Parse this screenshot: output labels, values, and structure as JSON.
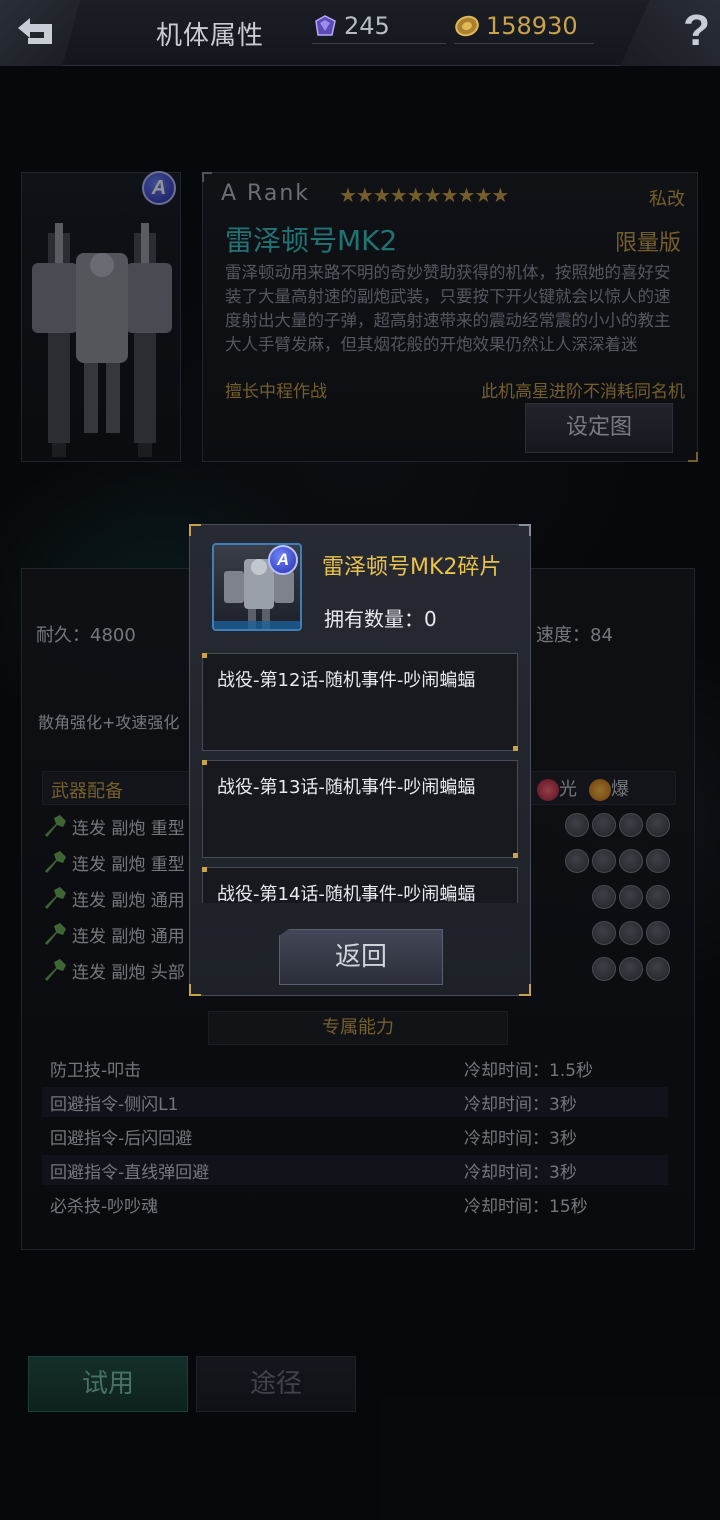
{
  "header": {
    "back_icon": "back-arrow-icon",
    "title": "机体属性",
    "diamonds": "245",
    "gold": "158930",
    "help_icon": "question-mark-icon"
  },
  "mech": {
    "rank_badge": "A",
    "rank_label": "A  Rank",
    "stars": "★★★★★★★★★★",
    "private_tag": "私改",
    "name": "雷泽顿号MK2",
    "limited_tag": "限量版",
    "description": "雷泽顿动用来路不明的奇妙赞助获得的机体，按照她的喜好安装了大量高射速的副炮武装，只要按下开火键就会以惊人的速度射出大量的子弹，超高射速带来的震动经常震的小小的教主大人手臂发麻，但其烟花般的开炮效果仍然让人深深着迷",
    "skill_tag": "擅长中程作战",
    "star_note": "此机高星进阶不消耗同名机",
    "set_image_label": "设定图"
  },
  "stats": {
    "durability": "耐久：4800",
    "speed": "速度：84",
    "buff": "散角强化+攻速强化",
    "weapon_header": "武器配备",
    "elements": [
      "光",
      "爆"
    ],
    "weapons": [
      {
        "name": "连发 副炮  重型",
        "slots": 4
      },
      {
        "name": "连发 副炮  重型",
        "slots": 4
      },
      {
        "name": "连发 副炮  通用",
        "slots": 3
      },
      {
        "name": "连发 副炮  通用",
        "slots": 3
      },
      {
        "name": "连发 副炮  头部",
        "slots": 3
      }
    ],
    "exclusive_header": "专属能力",
    "abilities": [
      {
        "name": "防卫技-叩击",
        "cooldown": "冷却时间：1.5秒"
      },
      {
        "name": "回避指令-侧闪L1",
        "cooldown": "冷却时间：3秒"
      },
      {
        "name": "回避指令-后闪回避",
        "cooldown": "冷却时间：3秒"
      },
      {
        "name": "回避指令-直线弹回避",
        "cooldown": "冷却时间：3秒"
      },
      {
        "name": "必杀技-吵吵魂",
        "cooldown": "冷却时间：15秒"
      }
    ]
  },
  "buttons": {
    "trial": "试用",
    "route": "途径"
  },
  "modal": {
    "fragment_name": "雷泽顿号MK2碎片",
    "owned_count": "拥有数量：0",
    "routes": [
      "战役-第12话-随机事件-吵闹蝙蝠",
      "战役-第13话-随机事件-吵闹蝙蝠",
      "战役-第14话-随机事件-吵闹蝙蝠"
    ],
    "back_label": "返回"
  },
  "colors": {
    "gold": "#c9a24a",
    "cyan": "#38c7c7",
    "fragment_title": "#e8c24a"
  }
}
